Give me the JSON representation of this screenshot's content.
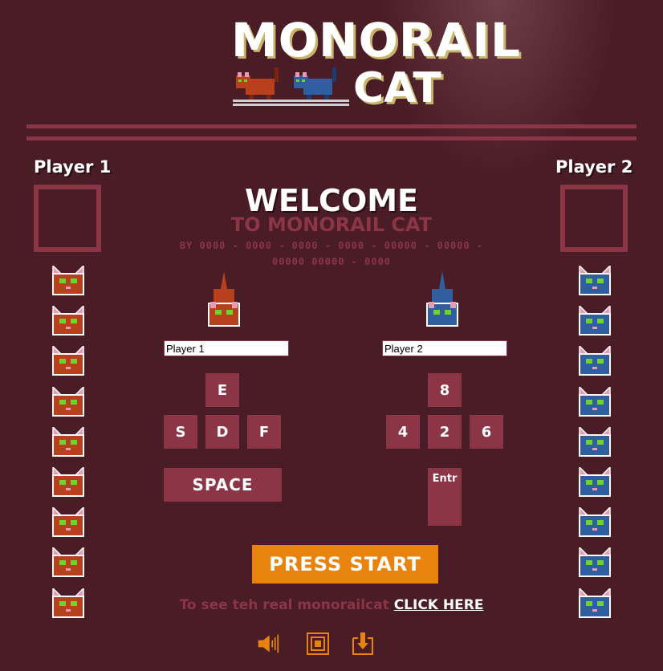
{
  "logo": {
    "line1": "MONORAIL",
    "line2": "CAT"
  },
  "players": [
    {
      "label": "Player 1",
      "name_value": "Player 1",
      "color": "#b8401c",
      "keys": {
        "up": "E",
        "left": "S",
        "down": "D",
        "right": "F",
        "action": "SPACE"
      }
    },
    {
      "label": "Player 2",
      "name_value": "Player 2",
      "color": "#2f5fa0",
      "keys": {
        "up": "8",
        "left": "4",
        "down": "2",
        "right": "6",
        "action": "Entr"
      }
    }
  ],
  "welcome": {
    "title": "WELCOME",
    "subtitle": "TO MONORAIL CAT",
    "credits": "BY 0000 - 0000 - 0000 - 0000 - 00000 - 00000 - 00000 00000 - 0000"
  },
  "start_button": "PRESS START",
  "footer": {
    "text": "To see teh real monorailcat ",
    "link": "CLICK HERE"
  },
  "lives_per_player": 9,
  "colors": {
    "background": "#4a1c25",
    "accent": "#8b3546",
    "start": "#e8830e"
  },
  "icons": [
    "sound-icon",
    "fullscreen-icon",
    "download-icon"
  ]
}
